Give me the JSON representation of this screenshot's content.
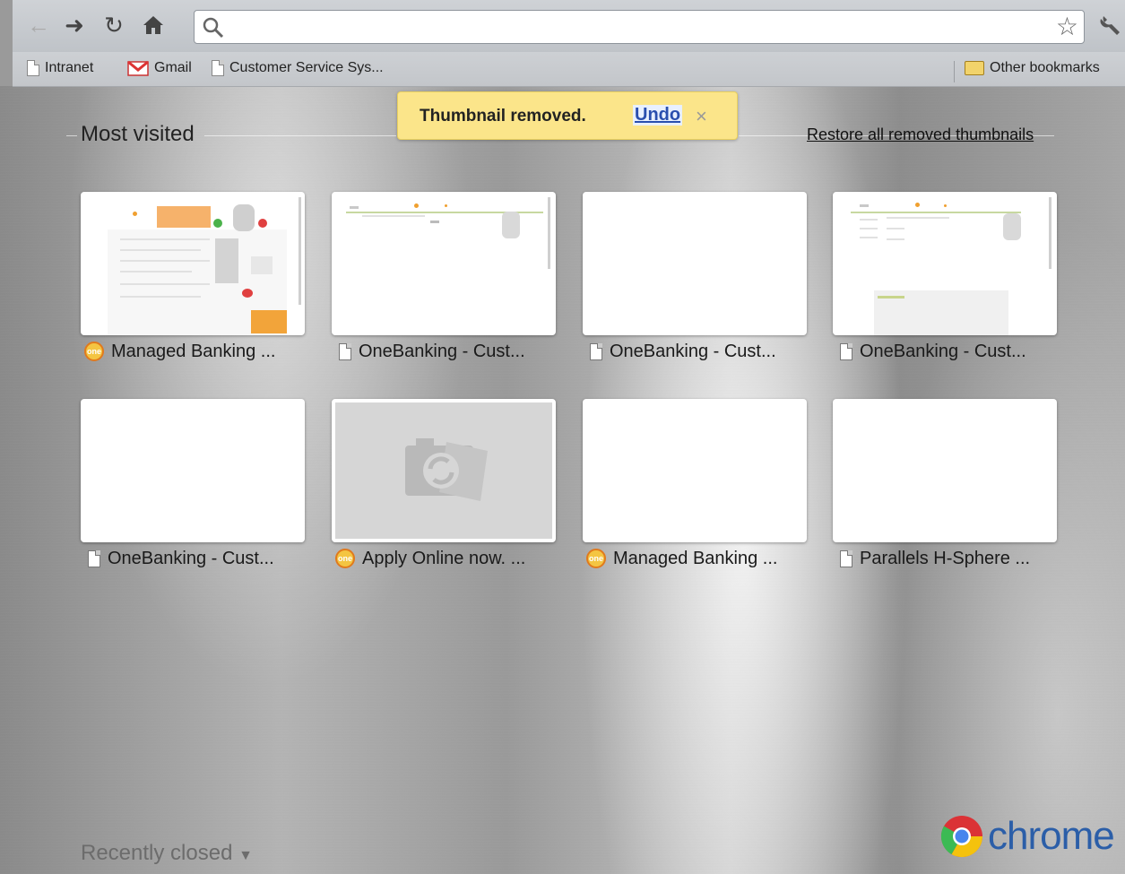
{
  "toolbar": {
    "omnibox_value": "",
    "icons": [
      "back-icon",
      "forward-icon",
      "reload-icon",
      "home-icon",
      "search-icon",
      "star-icon",
      "wrench-icon"
    ]
  },
  "bookmarks": {
    "items": [
      {
        "label": "Intranet",
        "icon": "page-icon"
      },
      {
        "label": "Gmail",
        "icon": "gmail-icon"
      },
      {
        "label": "Customer Service Sys...",
        "icon": "page-icon"
      }
    ],
    "other": "Other bookmarks"
  },
  "notification": {
    "message": "Thumbnail removed.",
    "undo": "Undo",
    "close": "×"
  },
  "most_visited": {
    "title": "Most visited",
    "restore": "Restore all removed thumbnails",
    "tiles": [
      {
        "label": "Managed Banking ...",
        "icon": "onebanking-icon",
        "preview": "managed-banking"
      },
      {
        "label": "OneBanking - Cust...",
        "icon": "page-icon",
        "preview": "onebanking-login"
      },
      {
        "label": "OneBanking - Cust...",
        "icon": "page-icon",
        "preview": "blank"
      },
      {
        "label": "OneBanking - Cust...",
        "icon": "page-icon",
        "preview": "onebanking-form"
      },
      {
        "label": "OneBanking - Cust...",
        "icon": "page-icon",
        "preview": "blank"
      },
      {
        "label": "Apply Online now. ...",
        "icon": "onebanking-icon",
        "preview": "no-thumbnail"
      },
      {
        "label": "Managed Banking ...",
        "icon": "onebanking-icon",
        "preview": "blank"
      },
      {
        "label": "Parallels H-Sphere ...",
        "icon": "page-icon",
        "preview": "blank"
      }
    ]
  },
  "footer": {
    "recently_closed": "Recently closed",
    "brand": "chrome"
  }
}
